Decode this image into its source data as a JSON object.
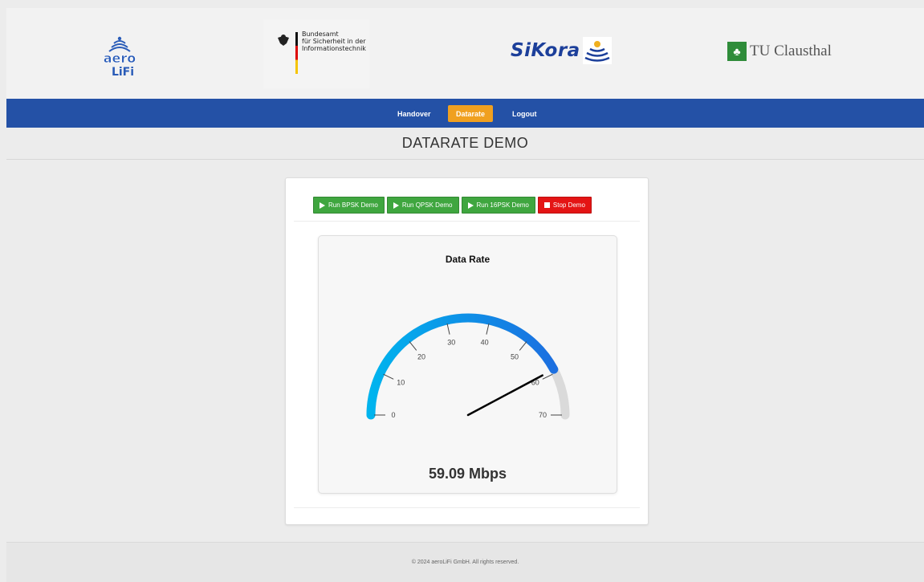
{
  "header": {
    "aero_logo_text": [
      "aero",
      "LiFi"
    ],
    "bsi_text": "Bundesamt\nfür Sicherheit in der\nInformationstechnik",
    "sikora_text": "SiKora",
    "tu_text": "TU Clausthal"
  },
  "nav": {
    "items": [
      {
        "label": "Handover",
        "active": false
      },
      {
        "label": "Datarate",
        "active": true
      },
      {
        "label": "Logout",
        "active": false
      }
    ]
  },
  "page": {
    "title": "DATARATE DEMO"
  },
  "controls": {
    "buttons": [
      {
        "label": "Run BPSK Demo",
        "icon": "play-icon",
        "color": "#3fa63f"
      },
      {
        "label": "Run QPSK Demo",
        "icon": "play-icon",
        "color": "#3fa63f"
      },
      {
        "label": "Run 16PSK Demo",
        "icon": "play-icon",
        "color": "#3fa63f"
      },
      {
        "label": "Stop Demo",
        "icon": "stop-icon",
        "color": "#e41414"
      }
    ]
  },
  "gauge": {
    "title": "Data Rate",
    "value_text": "59.09 Mbps",
    "value": 59.09,
    "min": 0,
    "max": 70,
    "ticks": [
      "0",
      "10",
      "20",
      "30",
      "40",
      "50",
      "60",
      "70"
    ],
    "gradient_start": "#00b4ee",
    "gradient_end": "#1c6fe0",
    "track_color": "#dadada",
    "needle_color": "#000000"
  },
  "footer": {
    "text": "© 2024 aeroLiFi GmbH. All rights reserved."
  }
}
